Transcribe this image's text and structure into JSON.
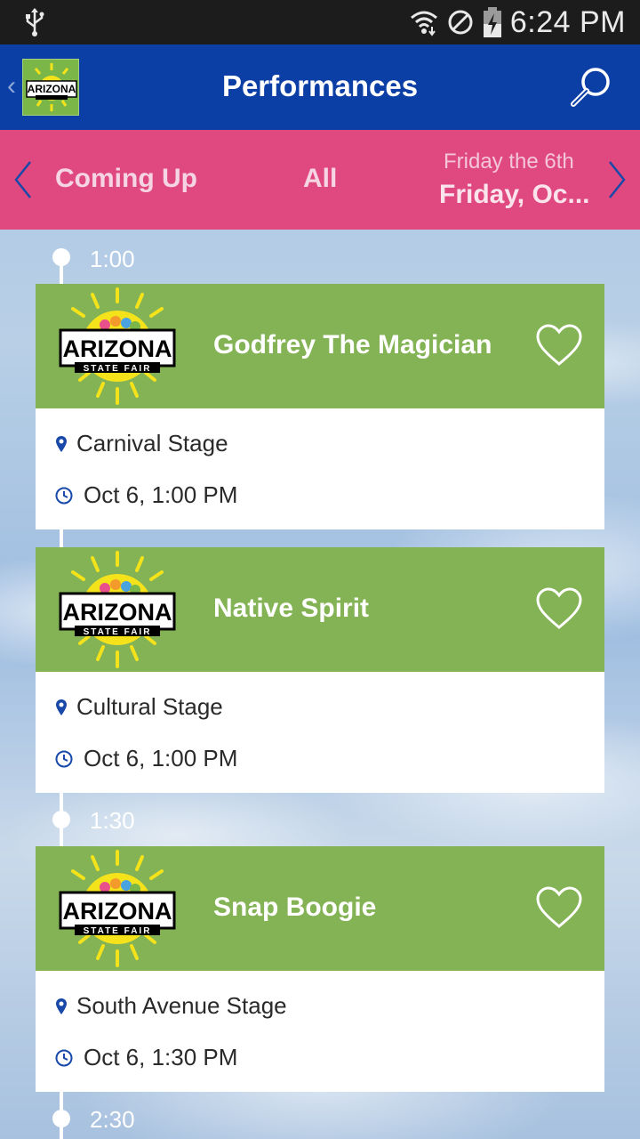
{
  "status_bar": {
    "time": "6:24 PM"
  },
  "app_bar": {
    "title": "Performances",
    "logo_text": "ARIZONA",
    "logo_subtext": "STATE FAIR"
  },
  "filter_bar": {
    "coming_up": "Coming Up",
    "all": "All",
    "day_subtitle": "Friday the 6th",
    "day_title": "Friday, Oc..."
  },
  "timeline": [
    {
      "time": "1:00"
    },
    {
      "time": "1:30"
    },
    {
      "time": "2:30"
    }
  ],
  "performances": [
    {
      "title": "Godfrey The Magician",
      "venue": "Carnival Stage",
      "datetime": "Oct 6, 1:00 PM"
    },
    {
      "title": "Native Spirit",
      "venue": "Cultural Stage",
      "datetime": "Oct 6, 1:00 PM"
    },
    {
      "title": "Snap Boogie",
      "venue": "South Avenue Stage",
      "datetime": "Oct 6, 1:30 PM"
    }
  ],
  "colors": {
    "app_bar": "#0b3fa6",
    "filter_bar": "#e0497f",
    "card_header": "#84b355",
    "icon_blue": "#1848a8"
  }
}
